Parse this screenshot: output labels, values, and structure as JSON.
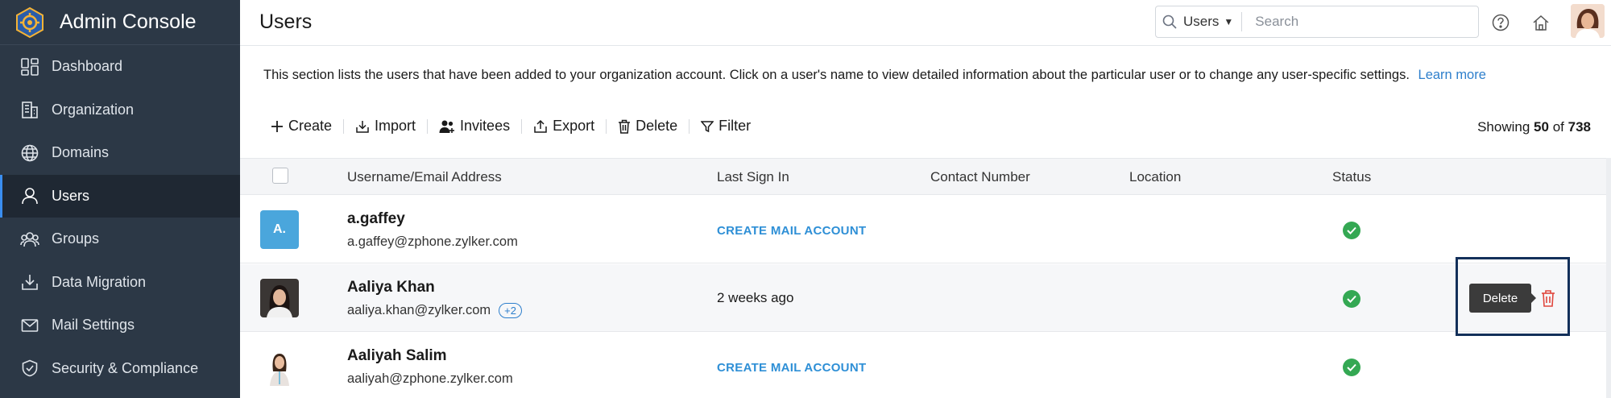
{
  "app": {
    "title": "Admin Console"
  },
  "sidebar": {
    "items": [
      {
        "label": "Dashboard",
        "icon": "dashboard-icon"
      },
      {
        "label": "Organization",
        "icon": "building-icon"
      },
      {
        "label": "Domains",
        "icon": "globe-icon"
      },
      {
        "label": "Users",
        "icon": "user-icon",
        "active": true
      },
      {
        "label": "Groups",
        "icon": "group-icon"
      },
      {
        "label": "Data Migration",
        "icon": "download-tray-icon"
      },
      {
        "label": "Mail Settings",
        "icon": "mail-icon"
      },
      {
        "label": "Security & Compliance",
        "icon": "shield-icon"
      }
    ]
  },
  "header": {
    "title": "Users",
    "search": {
      "scope": "Users",
      "placeholder": "Search"
    }
  },
  "main": {
    "description": "This section lists the users that have been added to your organization account. Click on a user's name to view detailed information about the particular user or to change any user-specific settings.",
    "learn_more": "Learn more",
    "toolbar": {
      "create": "Create",
      "import": "Import",
      "invitees": "Invitees",
      "export": "Export",
      "delete": "Delete",
      "filter": "Filter"
    },
    "showing": {
      "prefix": "Showing",
      "count": "50",
      "of": "of",
      "total": "738"
    },
    "columns": {
      "username": "Username/Email Address",
      "last_sign_in": "Last Sign In",
      "contact": "Contact Number",
      "location": "Location",
      "status": "Status"
    },
    "rows": [
      {
        "avatar_letter": "A.",
        "name": "a.gaffey",
        "email": "a.gaffey@zphone.zylker.com",
        "last_sign_in": "CREATE MAIL ACCOUNT"
      },
      {
        "name": "Aaliya Khan",
        "email": "aaliya.khan@zylker.com",
        "extra": "+2",
        "last_sign_in": "2 weeks ago"
      },
      {
        "name": "Aaliyah Salim",
        "email": "aaliyah@zphone.zylker.com",
        "last_sign_in": "CREATE MAIL ACCOUNT"
      }
    ],
    "tooltip": "Delete"
  },
  "colors": {
    "sidebar_bg": "#2c3846",
    "accent": "#2e7fcc",
    "status_ok": "#34a853",
    "delete_red": "#e0463d"
  }
}
